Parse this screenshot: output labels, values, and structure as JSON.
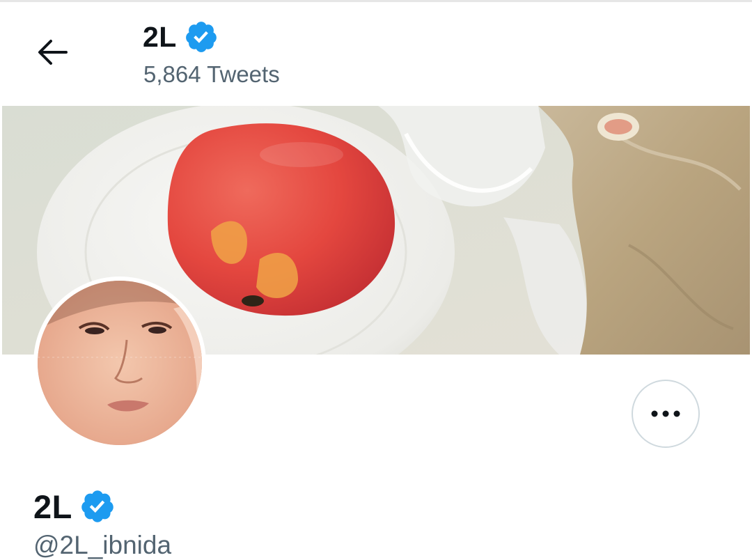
{
  "header": {
    "name": "2L",
    "tweet_count": "5,864 Tweets"
  },
  "profile": {
    "name": "2L",
    "handle": "@2L_ibnida",
    "verified": true
  },
  "colors": {
    "verified_badge": "#1d9bf0",
    "secondary_text": "#536471",
    "border": "#cfd9de"
  },
  "icons": {
    "back": "back-arrow-icon",
    "verified": "verified-badge-icon",
    "more": "more-dots-icon"
  }
}
